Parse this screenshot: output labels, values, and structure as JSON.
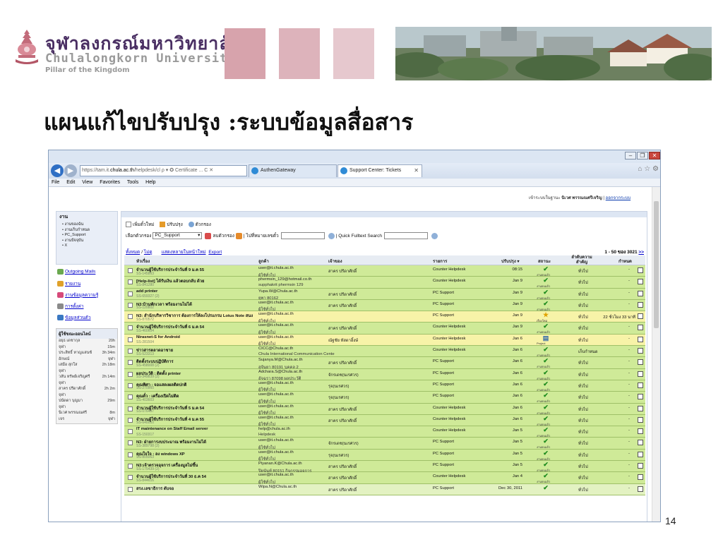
{
  "header": {
    "logo_thai": "จุฬาลงกรณ์มหาวิทยาลัย",
    "logo_english": "Chulalongkorn University",
    "logo_tagline": "Pillar of the Kingdom",
    "colors": {
      "brand_purple": "#4a2f63",
      "pink_1": "#d7a3ac",
      "pink_2": "#ddb3bb",
      "pink_3": "#e6c8ce"
    }
  },
  "slide": {
    "title": "แผนแก้ไขปรับปรุง :ระบบข้อมูลสื่อสาร",
    "page_number": "14"
  },
  "browser": {
    "address_prefix": "https://tam.it.",
    "address_host": "chula.ac.th",
    "address_rest": "/helpdesk/cl",
    "address_suffix": "ρ ▾ ✪ Certificate ... C ✕",
    "tabs": [
      {
        "label": "AuthenGateway"
      },
      {
        "label": "Support Center: Tickets"
      }
    ],
    "nav_icons": "⌂ ☆ ⚙",
    "menu": [
      "File",
      "Edit",
      "View",
      "Favorites",
      "Tools",
      "Help"
    ]
  },
  "app": {
    "user_prefix": "เข้าระบบในฐานะ",
    "user_name": "นิเวศ พรรณณศรีเจริญ",
    "logout": "ออกจากระบบ",
    "sidebar": {
      "title": "งาน",
      "items": [
        "• งานของฉัน",
        "• งานเก็บกำหนด",
        "• PC_Support",
        "• งานปัจจุบัน",
        "• X"
      ],
      "links": [
        "Outgoing Mails",
        "รายงาน",
        "งานข้อมูลความรู้",
        "การตั้งค่า",
        "ข้อมูลส่วนตัว"
      ]
    },
    "online": {
      "title": "ผู้ใช้ขณะออนไลน์",
      "users": [
        {
          "name": "อยุธ เดชากุล",
          "time": "20h"
        },
        {
          "name": "จุฬา",
          "time": "15m"
        },
        {
          "name": "ประสิทธิ์ หาญแสนซ์",
          "time": "3h 34m"
        },
        {
          "name": "อักษณ์",
          "time": "จุฬา"
        },
        {
          "name": "เสมือ สุกใส",
          "time": "2h 18m"
        },
        {
          "name": "จุฬา",
          "time": ""
        },
        {
          "name": "วสัน หรัพย์เจริญศรี",
          "time": "2h 14m"
        },
        {
          "name": "จุฬา",
          "time": ""
        },
        {
          "name": "สาคร ปรีดาศักดิ์",
          "time": "2h 2m"
        },
        {
          "name": "จุฬา",
          "time": ""
        },
        {
          "name": "ปนัดดา บุญมา",
          "time": "29m"
        },
        {
          "name": "จุฬา",
          "time": ""
        },
        {
          "name": "นิเวศ พรรณณศรี",
          "time": "8m"
        },
        {
          "name": "เจร",
          "time": "จุฬา"
        }
      ]
    },
    "toolbar": {
      "new_ticket": "เพิ่มตั๋วใหม่",
      "refresh": "ปรับปรุง",
      "filter": "ตัวกรอง",
      "filter_label": "เลือกตัวกรอง",
      "filter_value": "PC_Support",
      "clear_filter": "ลบตัวกรอง",
      "go_to_ticket": "ไปที่หมายเลขตั๋ว",
      "quick_search": "Quick Fulltext Search"
    },
    "views": {
      "all": "ทั้งหมด",
      "sep": "/",
      "unread": "ไม่ดู",
      "show_new": "แสดงหลายในหน้าใหม่",
      "export": "Export"
    },
    "pager": {
      "range": "1 - 50 ของ",
      "total": "3021",
      "next": ">>"
    },
    "columns": [
      "หัวเรื่อง",
      "ลูกค้า",
      "เจ้าของ",
      "รายการ",
      "ปรับปรุง ▾",
      "สถานะ",
      "ลำดับความสำคัญ",
      "กำหนด"
    ],
    "tickets": [
      {
        "subject": "จำนวนผู้ใช้บริการประจำวันที่ 9 ม.ค 55",
        "id": "SS-145863",
        "cust1": "user@it.chula.ac.th",
        "cust2": "ผู้ใช้ทั่วไป",
        "owner": "สาคร ปรีดาศักดิ์",
        "queue": "Counter Helpdesk",
        "updated": "08:15",
        "status_mark": "✔",
        "status": "งานจบแล้ว",
        "priority": "ทั่วไป",
        "due": "-"
      },
      {
        "subject": "[Help-list] ได้รับเงิน แล้วตอบกลับ ด้วย",
        "id": "SS-841280",
        "cust1": "phermsin_129@hotmail.co.th",
        "cust2": "supphakrit phermsin 129",
        "owner": "",
        "queue": "Counter Helpdesk",
        "updated": "Jan 9",
        "status_mark": "✔",
        "status": "งานจบแล้ว",
        "priority": "ทั่วไป",
        "due": "-"
      },
      {
        "subject": "add printer",
        "id": "SS-659327 (2)",
        "cust1": "Yupa.W@Chula.ac.th",
        "cust2": "ยุพา 80162",
        "owner": "สาคร ปรีดาศักดิ์",
        "queue": "PC Support",
        "updated": "Jan 9",
        "status_mark": "✔",
        "status": "งานจบแล้ว",
        "priority": "ทั่วไป",
        "due": "-"
      },
      {
        "subject": "N3:บ้านพักเวลา พร้อมงานไม่ได้",
        "id": "SS-120802",
        "cust1": "user@it.chula.ac.th",
        "cust2": "ผู้ใช้ทั่วไป",
        "owner": "สาคร ปรีดาศักดิ์",
        "queue": "PC Support",
        "updated": "Jan 9",
        "status_mark": "✔",
        "status": "งานจบแล้ว",
        "priority": "ทั่วไป",
        "due": "-"
      },
      {
        "subject": "N3: สำนักบริหารวิชาการ ต้องการให้ลงโปรแกรม Lotus Note สนง",
        "id": "SS-870572",
        "cust1": "user@it.chula.ac.th",
        "cust2": "ผู้ใช้ทั่วไป",
        "owner": "",
        "queue": "PC Support",
        "updated": "Jan 9",
        "status_mark": "★",
        "status": "เรื่องใหม่",
        "priority": "ทั่วไป",
        "due": "22 ชั่วโมง 33 นาที",
        "yellow": true
      },
      {
        "subject": "จำนวนผู้ใช้บริการประจำวันที่ 6 ม.ค 54",
        "id": "SS-460604",
        "cust1": "user@it.chula.ac.th",
        "cust2": "ผู้ใช้ทั่วไป",
        "owner": "สาคร ปรีดาศักดิ์",
        "queue": "Counter Helpdesk",
        "updated": "Jan 9",
        "status_mark": "✔",
        "status": "งานจบแล้ว",
        "priority": "ทั่วไป",
        "due": "-"
      },
      {
        "subject": "Nirasnet-S for Android",
        "id": "SS-281504",
        "cust1": "user@it.chula.ac.th",
        "cust2": "ผู้ใช้ทั่วไป",
        "owner": "ณัฐชัย หัสดาอิ้งษ์",
        "queue": "Counter Helpdesk",
        "updated": "Jan 6",
        "status_mark": "▤",
        "status": "Project",
        "priority": "ทั่วไป",
        "due": "-",
        "yellow": true
      },
      {
        "subject": "ข่าวสารตลาดอาชาย",
        "id": "SS-523313",
        "cust1": "CICC@Chula.ac.th",
        "cust2": "Chula International Communication Cente",
        "owner": "",
        "queue": "Counter Helpdesk",
        "updated": "Jan 6",
        "status_mark": "✔",
        "status": "งานจบแล้ว",
        "priority": "เก็บกำหนด",
        "due": "-"
      },
      {
        "subject": "ติดตั้งระบบปฏิบัติการ",
        "id": "SS-458008 (2)",
        "cust1": "Sujanya.M@Chula.ac.th",
        "cust2": "สุจันยา 80191 บุคคล 2",
        "owner": "สาคร ปรีดาศักดิ์",
        "queue": "PC Support",
        "updated": "Jan 6",
        "status_mark": "✔",
        "status": "งานจบแล้ว",
        "priority": "ทั่วไป",
        "due": "-"
      },
      {
        "subject": "ผลประวัติ : ติดตั้ง printer",
        "id": "SS-349839 (2)",
        "cust1": "Adchara.S@Chula.ac.th",
        "cust2": "อัจฉรา 87098 ผลประวัติ",
        "owner": "จักรเดช(นเรศวร)",
        "queue": "PC Support",
        "updated": "Jan 6",
        "status_mark": "✔",
        "status": "งานจบแล้ว",
        "priority": "ทั่วไป",
        "due": "-"
      },
      {
        "subject": "คุณพิศา : จอแสดงผลติดปกติ",
        "id": "SS-270960",
        "cust1": "user@it.chula.ac.th",
        "cust2": "ผู้ใช้ทั่วไป",
        "owner": "รุจ(นเรศวร)",
        "queue": "PC Support",
        "updated": "Jan 6",
        "status_mark": "✔",
        "status": "งานจบแล้ว",
        "priority": "ทั่วไป",
        "due": "-"
      },
      {
        "subject": "คุณตั๋ว : เครื่องเปิดไม่ติด",
        "id": "SS-403603",
        "cust1": "user@it.chula.ac.th",
        "cust2": "ผู้ใช้ทั่วไป",
        "owner": "รุจ(นเรศวร)",
        "queue": "PC Support",
        "updated": "Jan 6",
        "status_mark": "✔",
        "status": "งานจบแล้ว",
        "priority": "ทั่วไป",
        "due": "-"
      },
      {
        "subject": "จำนวนผู้ใช้บริการประจำวันที่ 5 ม.ค 54",
        "id": "SS-076487",
        "cust1": "user@it.chula.ac.th",
        "cust2": "ผู้ใช้ทั่วไป",
        "owner": "สาคร ปรีดาศักดิ์",
        "queue": "Counter Helpdesk",
        "updated": "Jan 6",
        "status_mark": "✔",
        "status": "งานจบแล้ว",
        "priority": "ทั่วไป",
        "due": "-"
      },
      {
        "subject": "จำนวนผู้ใช้บริการประจำวันที่ 4 ม.ค 55",
        "id": "SS-640010",
        "cust1": "user@it.chula.ac.th",
        "cust2": "ผู้ใช้ทั่วไป",
        "owner": "สาคร ปรีดาศักดิ์",
        "queue": "Counter Helpdesk",
        "updated": "Jan 6",
        "status_mark": "✔",
        "status": "งานจบแล้ว",
        "priority": "ทั่วไป",
        "due": "-"
      },
      {
        "subject": "IT maintenance on Staff Email server",
        "id": "SS-150317",
        "cust1": "help@chula.ac.th",
        "cust2": "Helpdesk",
        "owner": "",
        "queue": "Counter Helpdesk",
        "updated": "Jan 5",
        "status_mark": "✔",
        "status": "งานจบแล้ว",
        "priority": "ทั่วไป",
        "due": "-"
      },
      {
        "subject": "N3: ฝ่ายการงบประมาณ พร้อมงานไม่ได้",
        "id": "SS-389798 (2)",
        "cust1": "user@it.chula.ac.th",
        "cust2": "ผู้ใช้ทั่วไป",
        "owner": "จักรเดช(นเรศวร)",
        "queue": "PC Support",
        "updated": "Jan 5",
        "status_mark": "✔",
        "status": "งานจบแล้ว",
        "priority": "ทั่วไป",
        "due": "-"
      },
      {
        "subject": "คุณใจใจ : ลง windows XP",
        "id": "SS-805063",
        "cust1": "user@it.chula.ac.th",
        "cust2": "ผู้ใช้ทั่วไป",
        "owner": "รุจ(นเรศวร)",
        "queue": "PC Support",
        "updated": "Jan 5",
        "status_mark": "✔",
        "status": "งานจบแล้ว",
        "priority": "ทั่วไป",
        "due": "-"
      },
      {
        "subject": "N3:เจ้าตรวจอุจการ เครื่องมูลไม่ขึ้น",
        "id": "SS-175439 (2)",
        "cust1": "Piyanan.K@Chula.ac.th",
        "cust2": "ปิยนันท์ 80151 กิจกรรมอุจการ",
        "owner": "สาคร ปรีดาศักดิ์",
        "queue": "PC Support",
        "updated": "Jan 5",
        "status_mark": "✔",
        "status": "งานจบแล้ว",
        "priority": "ทั่วไป",
        "due": "-"
      },
      {
        "subject": "จำนวนผู้ใช้บริการประจำวันที่ 30 ธ.ค 54",
        "id": "SS-844616",
        "cust1": "user@it.chula.ac.th",
        "cust2": "ผู้ใช้ทั่วไป",
        "owner": "สาคร ปรีดาศักดิ์",
        "queue": "Counter Helpdesk",
        "updated": "Jan 4",
        "status_mark": "✔",
        "status": "งานจบแล้ว",
        "priority": "ทั่วไป",
        "due": "-"
      },
      {
        "subject": "สรง.เลขาธิการ ดับจอ",
        "id": "",
        "cust1": "Wipa.N@Chula.ac.th",
        "cust2": "",
        "owner": "สาคร ปรีดาศักดิ์",
        "queue": "PC Support",
        "updated": "Dec 30, 2011",
        "status_mark": "✔",
        "status": "",
        "priority": "ทั่วไป",
        "due": "-",
        "pale": true
      }
    ]
  }
}
